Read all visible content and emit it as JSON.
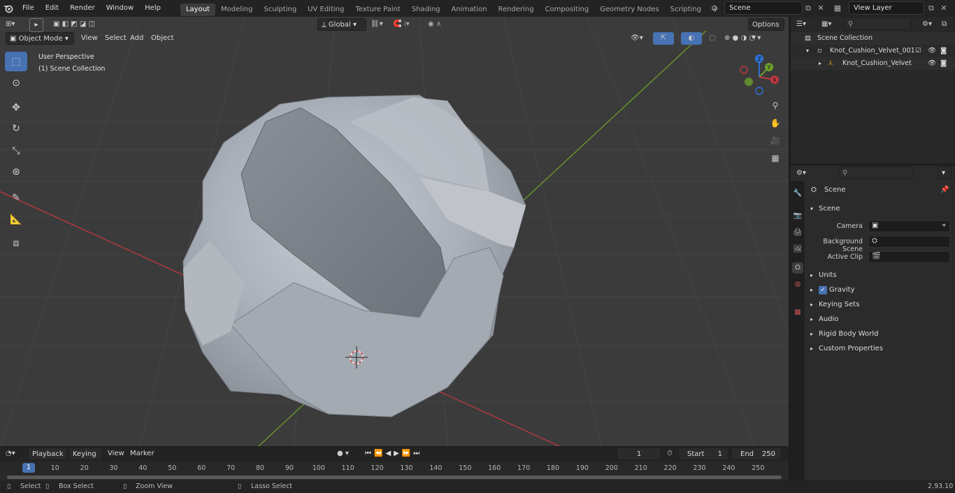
{
  "menu": [
    "File",
    "Edit",
    "Render",
    "Window",
    "Help"
  ],
  "workspace_tabs": [
    "Layout",
    "Modeling",
    "Sculpting",
    "UV Editing",
    "Texture Paint",
    "Shading",
    "Animation",
    "Rendering",
    "Compositing",
    "Geometry Nodes",
    "Scripting"
  ],
  "active_tab": "Layout",
  "scene_field": "Scene",
  "view_layer_field": "View Layer",
  "viewport": {
    "mode": "Object Mode",
    "header_menu": [
      "View",
      "Select",
      "Add",
      "Object"
    ],
    "transform_orientation": "Global",
    "options_label": "Options",
    "perspective_label": "User Perspective",
    "collection_label": "(1) Scene Collection",
    "gizmo_axes": {
      "x": "X",
      "y": "Y",
      "z": "Z"
    }
  },
  "outliner": {
    "rows": [
      {
        "label": "Scene Collection"
      },
      {
        "label": "Knot_Cushion_Velvet_001"
      },
      {
        "label": "Knot_Cushion_Velvet"
      }
    ]
  },
  "properties": {
    "header": "Scene",
    "section": "Scene",
    "fields": [
      {
        "label": "Camera"
      },
      {
        "label": "Background Scene"
      },
      {
        "label": "Active Clip"
      }
    ],
    "panels": [
      "Units",
      "Gravity",
      "Keying Sets",
      "Audio",
      "Rigid Body World",
      "Custom Properties"
    ],
    "gravity_checked": true
  },
  "timeline": {
    "menu": [
      "Playback",
      "Keying",
      "View",
      "Marker"
    ],
    "current_frame": "1",
    "start_label": "Start",
    "start_value": "1",
    "end_label": "End",
    "end_value": "250",
    "ticks": [
      "1",
      "10",
      "20",
      "30",
      "40",
      "50",
      "60",
      "70",
      "80",
      "90",
      "100",
      "110",
      "120",
      "130",
      "140",
      "150",
      "160",
      "170",
      "180",
      "190",
      "200",
      "210",
      "220",
      "230",
      "240",
      "250"
    ]
  },
  "statusbar": {
    "select": "Select",
    "box_select": "Box Select",
    "zoom_view": "Zoom View",
    "lasso_select": "Lasso Select",
    "version": "2.93.10"
  },
  "colors": {
    "accent": "#4772b3",
    "viewport_bg": "#3b3b3b",
    "x_axis": "#c0393f",
    "y_axis": "#6b9d2a"
  }
}
